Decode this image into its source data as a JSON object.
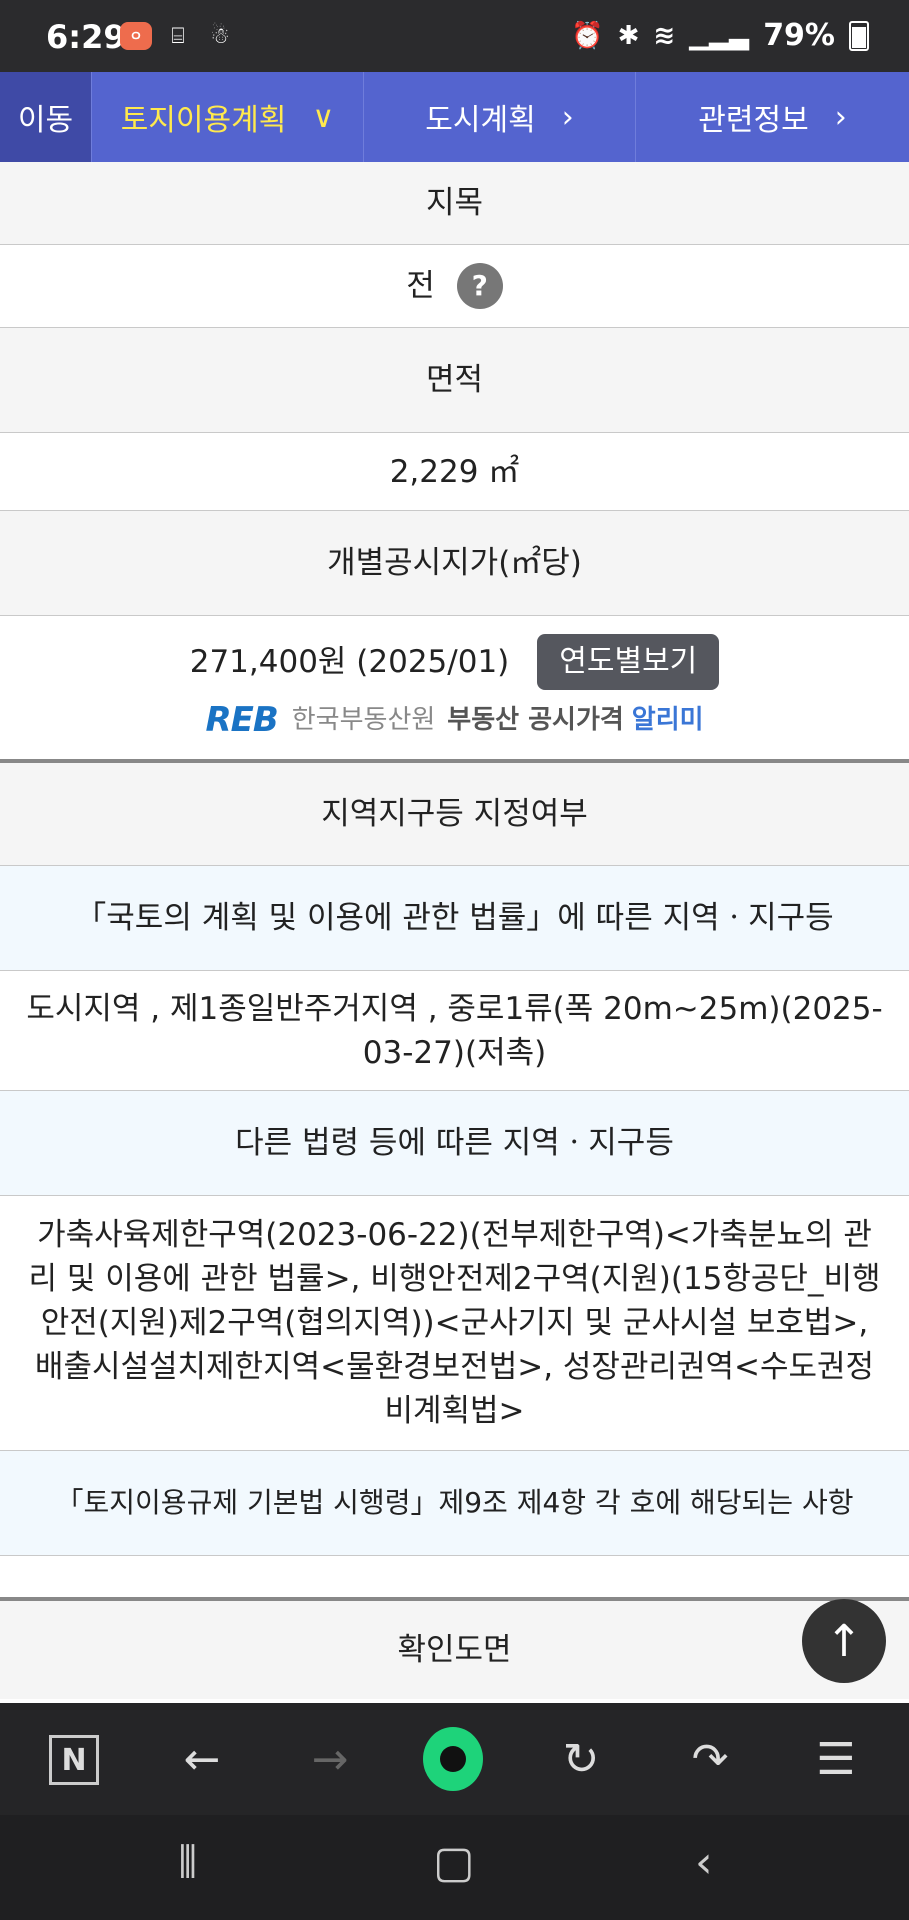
{
  "status": {
    "time": "6:29",
    "battery": "79%"
  },
  "tabs": {
    "move": "이동",
    "land_use": "토지이용계획",
    "city_plan": "도시계획",
    "related": "관련정보"
  },
  "land": {
    "jimok_label": "지목",
    "jimok_value": "전",
    "area_label": "면적",
    "area_value": "2,229 ㎡",
    "price_label": "개별공시지가(㎡당)",
    "price_value": "271,400원 (2025/01)",
    "year_button": "연도별보기",
    "reb_logo": "REB",
    "reb_org": "한국부동산원",
    "reb_service": "부동산 공시가격",
    "reb_alimi": "알리미"
  },
  "zoning": {
    "header": "지역지구등 지정여부",
    "national_law_header": "「국토의 계획 및 이용에 관한 법률」에 따른 지역ㆍ지구등",
    "national_law_value": "도시지역 , 제1종일반주거지역 , 중로1류(폭 20m~25m)(2025-03-27)(저촉)",
    "other_law_header": "다른 법령 등에 따른 지역ㆍ지구등",
    "other_law_value": "가축사육제한구역(2023-06-22)(전부제한구역)<가축분뇨의 관리 및 이용에 관한 법률>, 비행안전제2구역(지원)(15항공단_비행안전(지원)제2구역(협의지역))<군사기지 및 군사시설 보호법>, 배출시설설치제한지역<물환경보전법>, 성장관리권역<수도권정비계획법>",
    "enforcement_header": "「토지이용규제 기본법 시행령」제9조 제4항 각 호에 해당되는 사항",
    "enforcement_value": ""
  },
  "map": {
    "header": "확인도면"
  },
  "browser": {
    "n_label": "N"
  }
}
